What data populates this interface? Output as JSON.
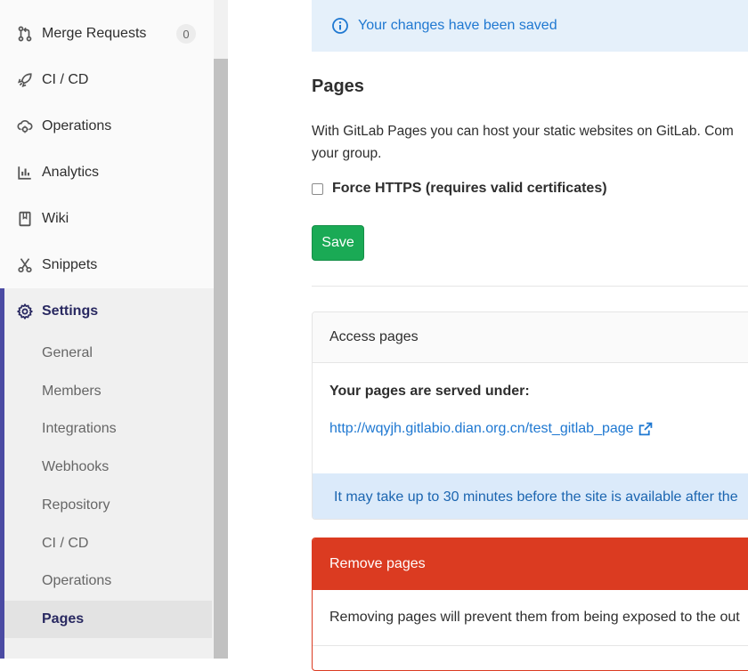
{
  "sidebar": {
    "items": [
      {
        "label": "Merge Requests",
        "icon": "merge-request-icon",
        "badge": "0"
      },
      {
        "label": "CI / CD",
        "icon": "rocket-icon"
      },
      {
        "label": "Operations",
        "icon": "cloud-gear-icon"
      },
      {
        "label": "Analytics",
        "icon": "chart-icon"
      },
      {
        "label": "Wiki",
        "icon": "book-icon"
      },
      {
        "label": "Snippets",
        "icon": "scissors-icon"
      }
    ],
    "settings": {
      "label": "Settings",
      "icon": "gear-icon",
      "subitems": [
        "General",
        "Members",
        "Integrations",
        "Webhooks",
        "Repository",
        "CI / CD",
        "Operations",
        "Pages"
      ],
      "active": "Pages"
    }
  },
  "alert": {
    "text": "Your changes have been saved",
    "icon": "info-circle-icon"
  },
  "page": {
    "title": "Pages",
    "description_line1": "With GitLab Pages you can host your static websites on GitLab. Com",
    "description_line2": "your group.",
    "force_https_label": "Force HTTPS (requires valid certificates)",
    "save_label": "Save"
  },
  "access_card": {
    "header": "Access pages",
    "served_label": "Your pages are served under:",
    "url": "http://wqyjh.gitlabio.dian.org.cn/test_gitlab_page",
    "link_icon": "external-link-icon",
    "info": "It may take up to 30 minutes before the site is available after the"
  },
  "remove_card": {
    "header": "Remove pages",
    "body": "Removing pages will prevent them from being exposed to the out"
  },
  "colors": {
    "accent": "#4b4ba3",
    "save_green": "#1aaa55",
    "danger": "#db3b21",
    "link": "#1f78d1"
  }
}
